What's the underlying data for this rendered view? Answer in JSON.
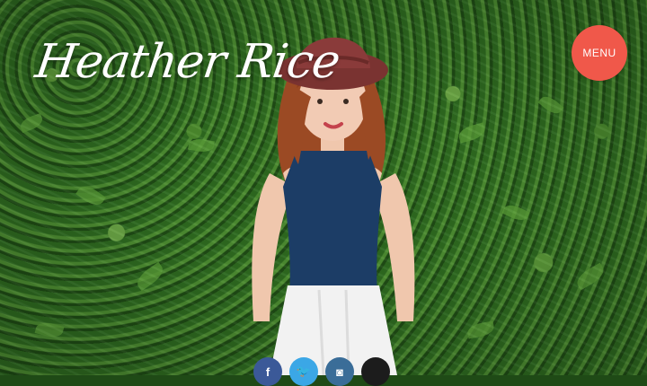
{
  "site": {
    "logo_text": "Heather Rice",
    "menu_label": "MENU"
  },
  "social": [
    {
      "name": "facebook-icon",
      "glyph": "f",
      "color": "#3b5998"
    },
    {
      "name": "twitter-icon",
      "glyph": "🐦",
      "color": "#3ba7e6"
    },
    {
      "name": "instagram-icon",
      "glyph": "◙",
      "color": "#3a6d98"
    },
    {
      "name": "apple-icon",
      "glyph": "",
      "color": "#1c1c1c"
    }
  ],
  "colors": {
    "menu_button": "#f0584a",
    "foliage": "#2f6d22",
    "top": "#1c3d66",
    "skirt": "#f2f2f2",
    "hat": "#8a3b3a",
    "hair": "#9b4a24"
  }
}
